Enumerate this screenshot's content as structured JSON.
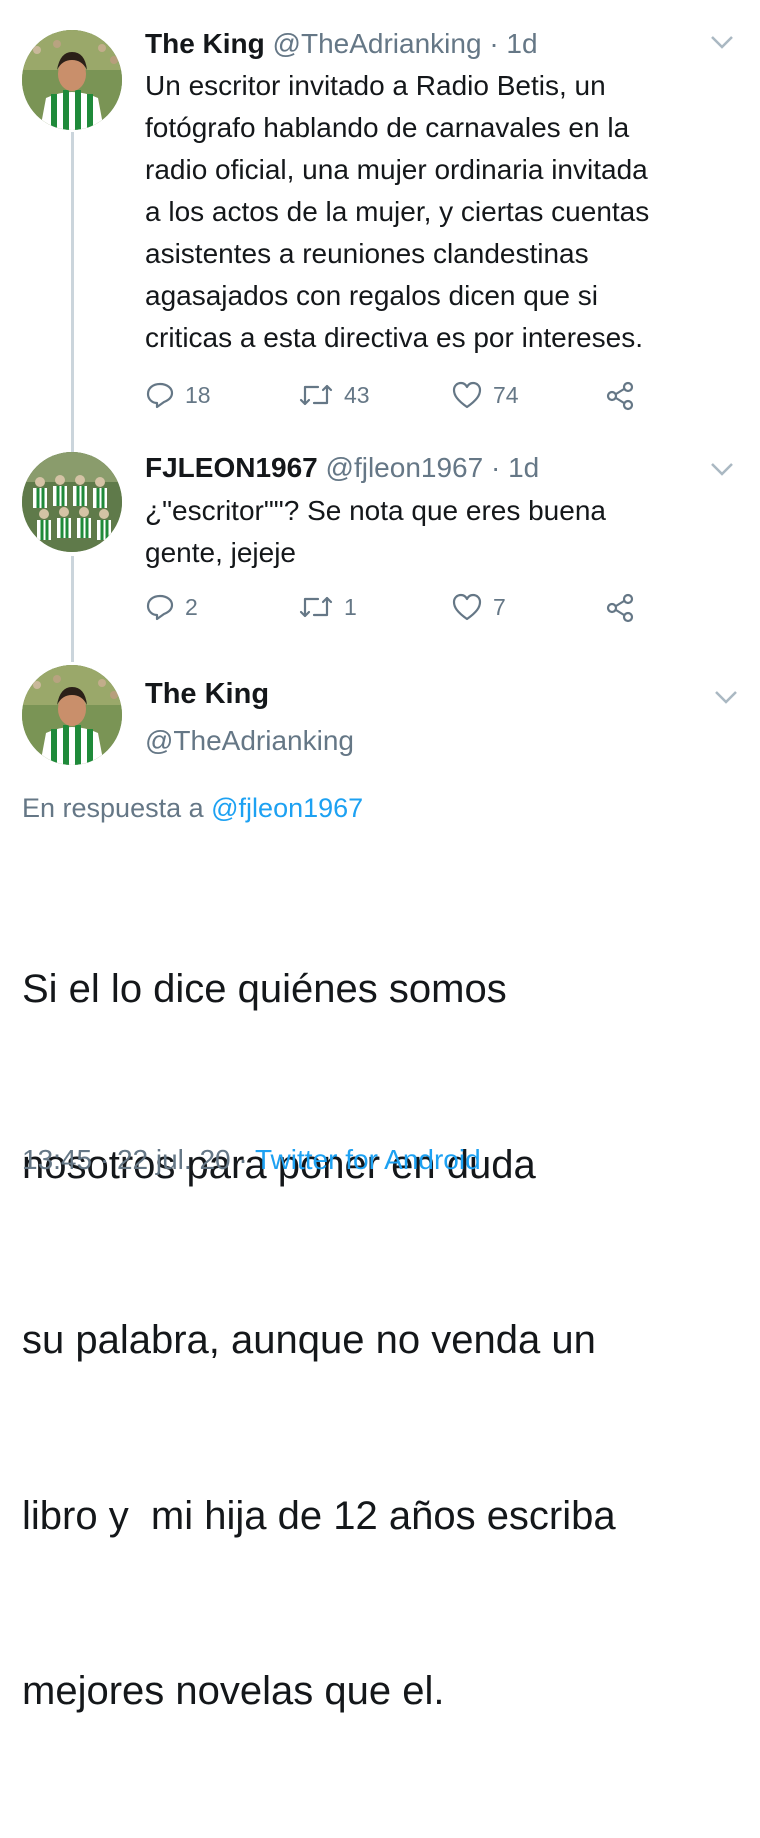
{
  "tweet1": {
    "name": "The King",
    "handle": "@TheAdrianking",
    "sep": "·",
    "time": "1d",
    "text_lines": [
      "Un escritor invitado a Radio Betis, un",
      "fotógrafo hablando de carnavales en la",
      "radio oficial, una mujer ordinaria invitada",
      "a los actos de la mujer, y ciertas cuentas",
      "asistentes a reuniones clandestinas",
      "agasajados con regalos dicen que si",
      "criticas a esta directiva es por intereses."
    ],
    "replies": "18",
    "retweets": "43",
    "likes": "74"
  },
  "tweet2": {
    "name": "FJLEON1967",
    "handle": "@fjleon1967",
    "sep": "·",
    "time": "1d",
    "text_lines": [
      "¿\"escritor\"\"? Se nota que eres buena",
      "gente, jejeje"
    ],
    "replies": "2",
    "retweets": "1",
    "likes": "7"
  },
  "main": {
    "name": "The King",
    "handle": "@TheAdrianking",
    "reply_prefix": "En respuesta a",
    "reply_to": "@fjleon1967",
    "text_lines": [
      "Si el lo dice quiénes somos",
      "nosotros para poner en duda",
      "su palabra, aunque no venda un",
      "libro y  mi hija de 12 años escriba",
      "mejores novelas que el."
    ],
    "time": "13:45",
    "sep1": "·",
    "date": "22 jul. 20",
    "sep2": "·",
    "source": "Twitter for Android"
  },
  "colors": {
    "text": "#14171a",
    "secondary": "#657786",
    "link": "#1da1f2",
    "thread_line": "#cbd5dc"
  },
  "icons": [
    "reply-icon",
    "retweet-icon",
    "like-icon",
    "share-icon",
    "chevron-down-icon"
  ]
}
